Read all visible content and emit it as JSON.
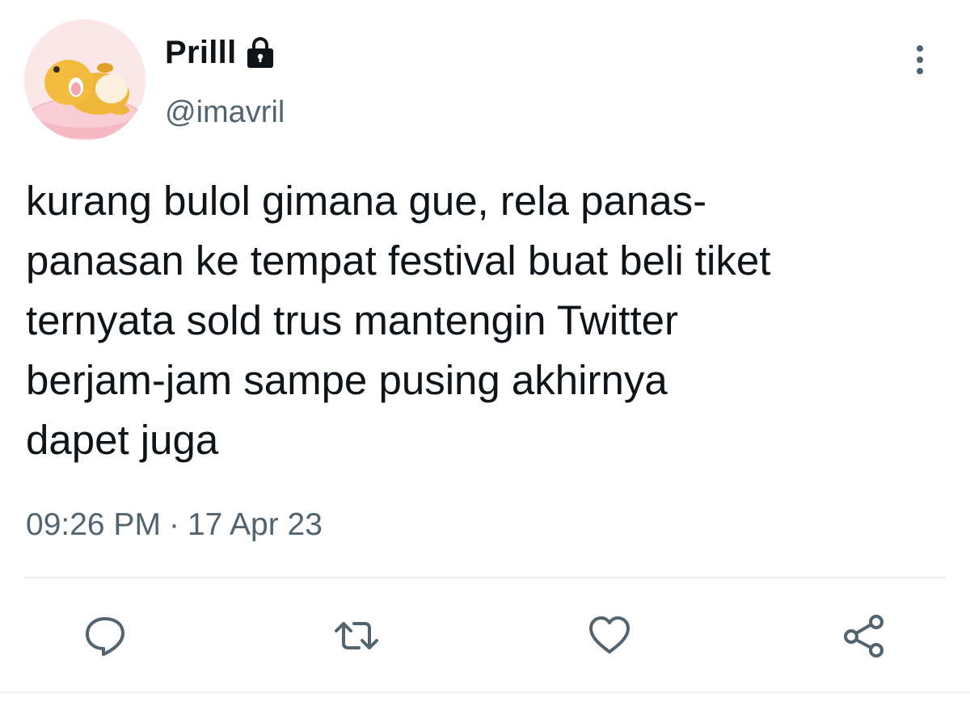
{
  "user": {
    "display_name": "Prilll",
    "handle": "@imavril",
    "protected_icon": "lock-icon",
    "avatar_icon": "avatar"
  },
  "tweet": {
    "lines": [
      "kurang bulol gimana gue, rela panas-",
      "panasan ke tempat festival buat beli tiket",
      "ternyata sold trus mantengin Twitter",
      "berjam-jam sampe pusing akhirnya",
      "dapet juga"
    ],
    "time": "09:26 PM",
    "separator": "·",
    "date": "17 Apr 23"
  },
  "actions": [
    {
      "name": "reply",
      "icon": "reply-icon"
    },
    {
      "name": "retweet",
      "icon": "retweet-icon"
    },
    {
      "name": "like",
      "icon": "heart-icon"
    },
    {
      "name": "share",
      "icon": "share-icon"
    }
  ],
  "colors": {
    "text": "#0f1419",
    "secondary": "#536471",
    "divider": "#e6ebee"
  }
}
